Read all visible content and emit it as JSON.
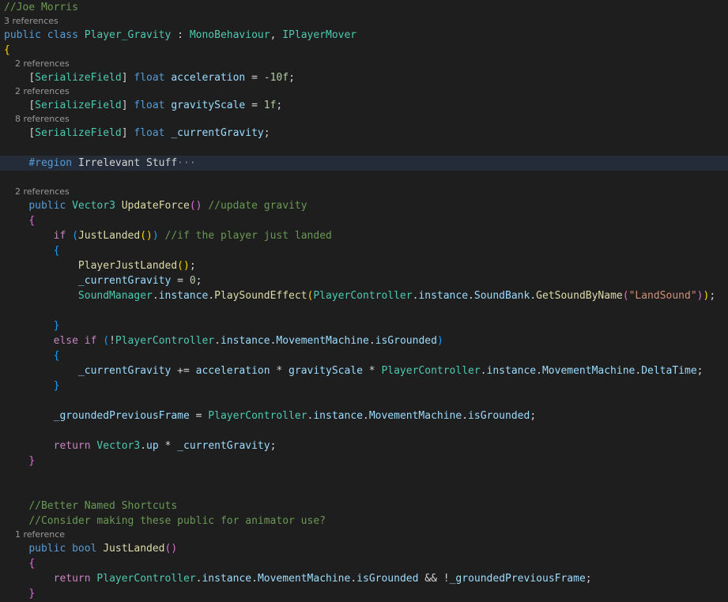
{
  "editor": {
    "colors": {
      "background": "#1e1e1e",
      "keyword": "#569cd6",
      "control": "#c586c0",
      "type": "#4ec9b0",
      "function": "#dcdcaa",
      "variable": "#9cdcfe",
      "number": "#b5cea8",
      "string": "#ce9178",
      "comment": "#6a9955",
      "codelens": "#999999"
    },
    "lines": [
      {
        "type": "code",
        "tokens": [
          {
            "t": "//Joe Morris",
            "c": "cmt"
          }
        ]
      },
      {
        "type": "lens",
        "text": "3 references"
      },
      {
        "type": "code",
        "tokens": [
          {
            "t": "public class ",
            "c": "kw"
          },
          {
            "t": "Player_Gravity",
            "c": "type"
          },
          {
            "t": " : ",
            "c": "plain"
          },
          {
            "t": "MonoBehaviour",
            "c": "type"
          },
          {
            "t": ", ",
            "c": "plain"
          },
          {
            "t": "IPlayerMover",
            "c": "type"
          }
        ]
      },
      {
        "type": "code",
        "tokens": [
          {
            "t": "{",
            "c": "br1"
          }
        ]
      },
      {
        "type": "lens",
        "text": "    2 references"
      },
      {
        "type": "code",
        "tokens": [
          {
            "t": "    ",
            "c": "plain"
          },
          {
            "t": "[",
            "c": "plain"
          },
          {
            "t": "SerializeField",
            "c": "type"
          },
          {
            "t": "] ",
            "c": "plain"
          },
          {
            "t": "float ",
            "c": "kw"
          },
          {
            "t": "acceleration",
            "c": "var"
          },
          {
            "t": " = ",
            "c": "plain"
          },
          {
            "t": "-10f",
            "c": "num"
          },
          {
            "t": ";",
            "c": "plain"
          }
        ]
      },
      {
        "type": "lens",
        "text": "    2 references"
      },
      {
        "type": "code",
        "tokens": [
          {
            "t": "    ",
            "c": "plain"
          },
          {
            "t": "[",
            "c": "plain"
          },
          {
            "t": "SerializeField",
            "c": "type"
          },
          {
            "t": "] ",
            "c": "plain"
          },
          {
            "t": "float ",
            "c": "kw"
          },
          {
            "t": "gravityScale",
            "c": "var"
          },
          {
            "t": " = ",
            "c": "plain"
          },
          {
            "t": "1f",
            "c": "num"
          },
          {
            "t": ";",
            "c": "plain"
          }
        ]
      },
      {
        "type": "lens",
        "text": "    8 references"
      },
      {
        "type": "code",
        "tokens": [
          {
            "t": "    ",
            "c": "plain"
          },
          {
            "t": "[",
            "c": "plain"
          },
          {
            "t": "SerializeField",
            "c": "type"
          },
          {
            "t": "] ",
            "c": "plain"
          },
          {
            "t": "float ",
            "c": "kw"
          },
          {
            "t": "_currentGravity",
            "c": "var"
          },
          {
            "t": ";",
            "c": "plain"
          }
        ]
      },
      {
        "type": "blank"
      },
      {
        "type": "code",
        "highlight": true,
        "tokens": [
          {
            "t": "    ",
            "c": "plain"
          },
          {
            "t": "#region ",
            "c": "kw"
          },
          {
            "t": "Irrelevant Stuff",
            "c": "plain"
          },
          {
            "t": "···",
            "c": "ellipsis"
          }
        ]
      },
      {
        "type": "blank"
      },
      {
        "type": "lens",
        "text": "    2 references"
      },
      {
        "type": "code",
        "tokens": [
          {
            "t": "    ",
            "c": "plain"
          },
          {
            "t": "public ",
            "c": "kw"
          },
          {
            "t": "Vector3",
            "c": "type"
          },
          {
            "t": " ",
            "c": "plain"
          },
          {
            "t": "UpdateForce",
            "c": "fn"
          },
          {
            "t": "()",
            "c": "br2"
          },
          {
            "t": " ",
            "c": "plain"
          },
          {
            "t": "//update gravity",
            "c": "cmt"
          }
        ]
      },
      {
        "type": "code",
        "tokens": [
          {
            "t": "    ",
            "c": "plain"
          },
          {
            "t": "{",
            "c": "br2"
          }
        ]
      },
      {
        "type": "code",
        "tokens": [
          {
            "t": "        ",
            "c": "plain"
          },
          {
            "t": "if ",
            "c": "ctrl"
          },
          {
            "t": "(",
            "c": "br3"
          },
          {
            "t": "JustLanded",
            "c": "fn"
          },
          {
            "t": "()",
            "c": "br1"
          },
          {
            "t": ")",
            "c": "br3"
          },
          {
            "t": " ",
            "c": "plain"
          },
          {
            "t": "//if the player just landed",
            "c": "cmt"
          }
        ]
      },
      {
        "type": "code",
        "tokens": [
          {
            "t": "        ",
            "c": "plain"
          },
          {
            "t": "{",
            "c": "br3"
          }
        ]
      },
      {
        "type": "code",
        "tokens": [
          {
            "t": "            ",
            "c": "plain"
          },
          {
            "t": "PlayerJustLanded",
            "c": "fn"
          },
          {
            "t": "()",
            "c": "br1"
          },
          {
            "t": ";",
            "c": "plain"
          }
        ]
      },
      {
        "type": "code",
        "tokens": [
          {
            "t": "            ",
            "c": "plain"
          },
          {
            "t": "_currentGravity",
            "c": "var"
          },
          {
            "t": " = ",
            "c": "plain"
          },
          {
            "t": "0",
            "c": "num"
          },
          {
            "t": ";",
            "c": "plain"
          }
        ]
      },
      {
        "type": "code",
        "tokens": [
          {
            "t": "            ",
            "c": "plain"
          },
          {
            "t": "SoundManager",
            "c": "type"
          },
          {
            "t": ".",
            "c": "plain"
          },
          {
            "t": "instance",
            "c": "var"
          },
          {
            "t": ".",
            "c": "plain"
          },
          {
            "t": "PlaySoundEffect",
            "c": "fn"
          },
          {
            "t": "(",
            "c": "br1"
          },
          {
            "t": "PlayerController",
            "c": "type"
          },
          {
            "t": ".",
            "c": "plain"
          },
          {
            "t": "instance",
            "c": "var"
          },
          {
            "t": ".",
            "c": "plain"
          },
          {
            "t": "SoundBank",
            "c": "var"
          },
          {
            "t": ".",
            "c": "plain"
          },
          {
            "t": "GetSoundByName",
            "c": "fn"
          },
          {
            "t": "(",
            "c": "br2"
          },
          {
            "t": "\"LandSound\"",
            "c": "str"
          },
          {
            "t": ")",
            "c": "br2"
          },
          {
            "t": ")",
            "c": "br1"
          },
          {
            "t": ";",
            "c": "plain"
          }
        ]
      },
      {
        "type": "blank"
      },
      {
        "type": "code",
        "tokens": [
          {
            "t": "        ",
            "c": "plain"
          },
          {
            "t": "}",
            "c": "br3"
          }
        ]
      },
      {
        "type": "code",
        "tokens": [
          {
            "t": "        ",
            "c": "plain"
          },
          {
            "t": "else if ",
            "c": "ctrl"
          },
          {
            "t": "(",
            "c": "br3"
          },
          {
            "t": "!",
            "c": "plain"
          },
          {
            "t": "PlayerController",
            "c": "type"
          },
          {
            "t": ".",
            "c": "plain"
          },
          {
            "t": "instance",
            "c": "var"
          },
          {
            "t": ".",
            "c": "plain"
          },
          {
            "t": "MovementMachine",
            "c": "var"
          },
          {
            "t": ".",
            "c": "plain"
          },
          {
            "t": "isGrounded",
            "c": "var"
          },
          {
            "t": ")",
            "c": "br3"
          }
        ]
      },
      {
        "type": "code",
        "tokens": [
          {
            "t": "        ",
            "c": "plain"
          },
          {
            "t": "{",
            "c": "br3"
          }
        ]
      },
      {
        "type": "code",
        "tokens": [
          {
            "t": "            ",
            "c": "plain"
          },
          {
            "t": "_currentGravity",
            "c": "var"
          },
          {
            "t": " += ",
            "c": "plain"
          },
          {
            "t": "acceleration",
            "c": "var"
          },
          {
            "t": " * ",
            "c": "plain"
          },
          {
            "t": "gravityScale",
            "c": "var"
          },
          {
            "t": " * ",
            "c": "plain"
          },
          {
            "t": "PlayerController",
            "c": "type"
          },
          {
            "t": ".",
            "c": "plain"
          },
          {
            "t": "instance",
            "c": "var"
          },
          {
            "t": ".",
            "c": "plain"
          },
          {
            "t": "MovementMachine",
            "c": "var"
          },
          {
            "t": ".",
            "c": "plain"
          },
          {
            "t": "DeltaTime",
            "c": "var"
          },
          {
            "t": ";",
            "c": "plain"
          }
        ]
      },
      {
        "type": "code",
        "tokens": [
          {
            "t": "        ",
            "c": "plain"
          },
          {
            "t": "}",
            "c": "br3"
          }
        ]
      },
      {
        "type": "blank"
      },
      {
        "type": "code",
        "tokens": [
          {
            "t": "        ",
            "c": "plain"
          },
          {
            "t": "_groundedPreviousFrame",
            "c": "var"
          },
          {
            "t": " = ",
            "c": "plain"
          },
          {
            "t": "PlayerController",
            "c": "type"
          },
          {
            "t": ".",
            "c": "plain"
          },
          {
            "t": "instance",
            "c": "var"
          },
          {
            "t": ".",
            "c": "plain"
          },
          {
            "t": "MovementMachine",
            "c": "var"
          },
          {
            "t": ".",
            "c": "plain"
          },
          {
            "t": "isGrounded",
            "c": "var"
          },
          {
            "t": ";",
            "c": "plain"
          }
        ]
      },
      {
        "type": "blank"
      },
      {
        "type": "code",
        "tokens": [
          {
            "t": "        ",
            "c": "plain"
          },
          {
            "t": "return ",
            "c": "ctrl"
          },
          {
            "t": "Vector3",
            "c": "type"
          },
          {
            "t": ".",
            "c": "plain"
          },
          {
            "t": "up",
            "c": "var"
          },
          {
            "t": " * ",
            "c": "plain"
          },
          {
            "t": "_currentGravity",
            "c": "var"
          },
          {
            "t": ";",
            "c": "plain"
          }
        ]
      },
      {
        "type": "code",
        "tokens": [
          {
            "t": "    ",
            "c": "plain"
          },
          {
            "t": "}",
            "c": "br2"
          }
        ]
      },
      {
        "type": "blank"
      },
      {
        "type": "blank"
      },
      {
        "type": "code",
        "tokens": [
          {
            "t": "    ",
            "c": "plain"
          },
          {
            "t": "//Better Named Shortcuts",
            "c": "cmt"
          }
        ]
      },
      {
        "type": "code",
        "tokens": [
          {
            "t": "    ",
            "c": "plain"
          },
          {
            "t": "//Consider making these public for animator use?",
            "c": "cmt"
          }
        ]
      },
      {
        "type": "lens",
        "text": "    1 reference"
      },
      {
        "type": "code",
        "tokens": [
          {
            "t": "    ",
            "c": "plain"
          },
          {
            "t": "public bool ",
            "c": "kw"
          },
          {
            "t": "JustLanded",
            "c": "fn"
          },
          {
            "t": "()",
            "c": "br2"
          }
        ]
      },
      {
        "type": "code",
        "tokens": [
          {
            "t": "    ",
            "c": "plain"
          },
          {
            "t": "{",
            "c": "br2"
          }
        ]
      },
      {
        "type": "code",
        "tokens": [
          {
            "t": "        ",
            "c": "plain"
          },
          {
            "t": "return ",
            "c": "ctrl"
          },
          {
            "t": "PlayerController",
            "c": "type"
          },
          {
            "t": ".",
            "c": "plain"
          },
          {
            "t": "instance",
            "c": "var"
          },
          {
            "t": ".",
            "c": "plain"
          },
          {
            "t": "MovementMachine",
            "c": "var"
          },
          {
            "t": ".",
            "c": "plain"
          },
          {
            "t": "isGrounded",
            "c": "var"
          },
          {
            "t": " && !",
            "c": "plain"
          },
          {
            "t": "_groundedPreviousFrame",
            "c": "var"
          },
          {
            "t": ";",
            "c": "plain"
          }
        ]
      },
      {
        "type": "code",
        "tokens": [
          {
            "t": "    ",
            "c": "plain"
          },
          {
            "t": "}",
            "c": "br2"
          }
        ]
      }
    ]
  }
}
